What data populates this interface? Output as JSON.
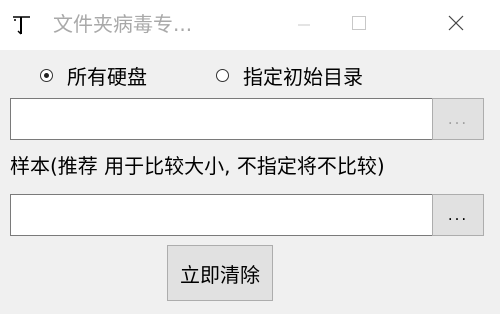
{
  "window": {
    "title": "文件夹病毒专...",
    "title_color": "#a9a9a9"
  },
  "scope": {
    "options": [
      {
        "label": "所有硬盘",
        "selected": true
      },
      {
        "label": "指定初始目录",
        "selected": false
      }
    ]
  },
  "directory": {
    "value": "",
    "browse_label": "...",
    "browse_enabled": false
  },
  "sample": {
    "label": "样本(推荐 用于比较大小, 不指定将不比较)",
    "value": "",
    "browse_label": "...",
    "browse_enabled": true
  },
  "actions": {
    "clear_label": "立即清除"
  },
  "icons": {
    "app": "app-icon",
    "minimize": "minimize-icon",
    "maximize": "maximize-icon",
    "close": "close-icon"
  }
}
